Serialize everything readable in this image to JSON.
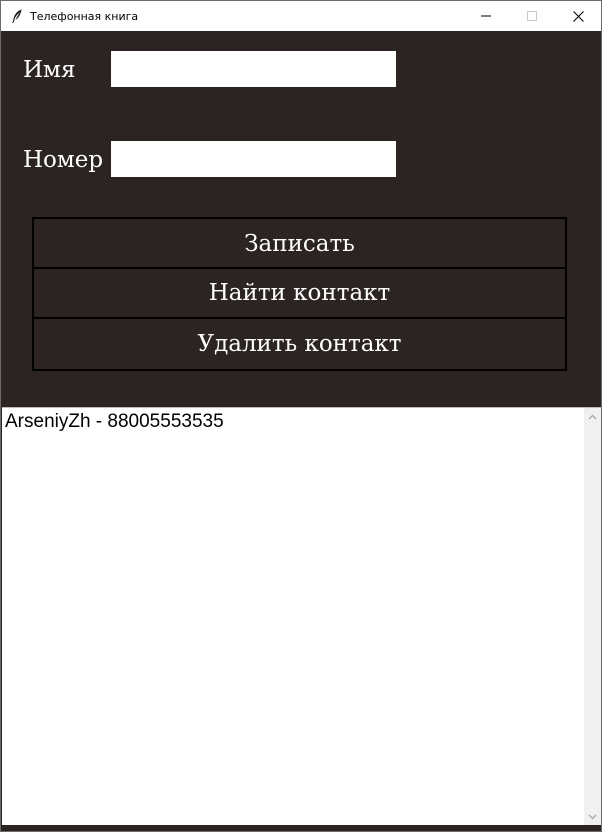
{
  "window": {
    "title": "Телефонная книга",
    "icon": "feather-icon"
  },
  "form": {
    "name_label": "Имя",
    "name_value": "",
    "number_label": "Номер",
    "number_value": ""
  },
  "buttons": {
    "save": "Записать",
    "find": "Найти контакт",
    "delete": "Удалить контакт"
  },
  "contacts": [
    "ArseniyZh - 88005553535"
  ],
  "colors": {
    "background": "#2b2422",
    "button_border": "#000000",
    "text": "#ffffff"
  }
}
